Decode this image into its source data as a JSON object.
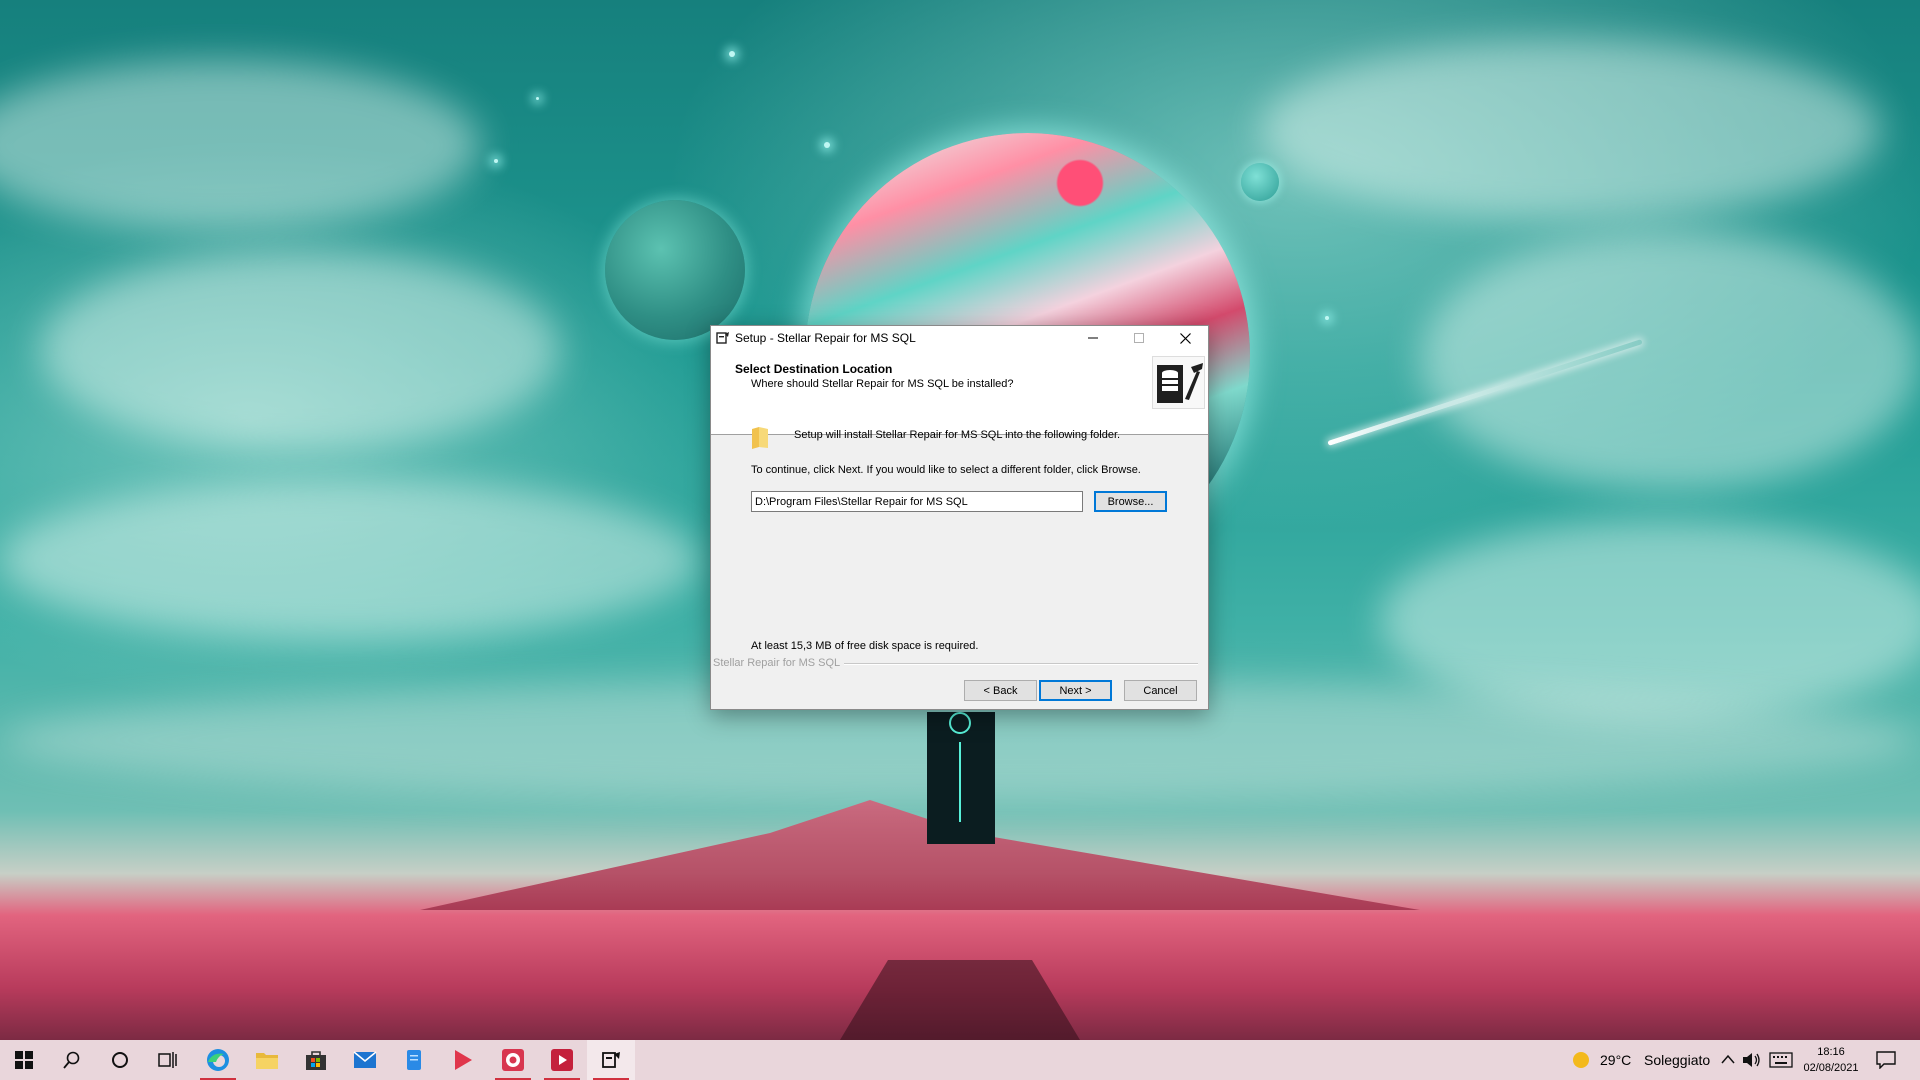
{
  "dialog": {
    "title": "Setup - Stellar Repair for MS SQL",
    "header_title": "Select Destination Location",
    "header_subtitle": "Where should Stellar Repair for MS SQL be installed?",
    "install_text": "Setup will install Stellar Repair for MS SQL into the following folder.",
    "continue_text": "To continue, click Next. If you would like to select a different folder, click Browse.",
    "path_value": "D:\\Program Files\\Stellar Repair for MS SQL",
    "browse_label": "Browse...",
    "space_text": "At least 15,3 MB of free disk space is required.",
    "brand_label": "Stellar Repair for MS SQL",
    "back_label": "< Back",
    "next_label": "Next >",
    "cancel_label": "Cancel"
  },
  "taskbar": {
    "icons": [
      "windows-start-icon",
      "search-icon",
      "cortana-icon",
      "task-view-icon",
      "edge-icon",
      "file-explorer-icon",
      "store-icon",
      "mail-icon",
      "document-icon",
      "media-player-icon",
      "chrome-app-icon",
      "video-app-icon",
      "setup-app-icon"
    ],
    "weather_temp": "29°C",
    "weather_desc": "Soleggiato",
    "time": "18:16",
    "date": "02/08/2021"
  },
  "colors": {
    "accent": "#0078d7",
    "taskbar": "#e9d6db",
    "active_indicator": "#d0313f"
  }
}
